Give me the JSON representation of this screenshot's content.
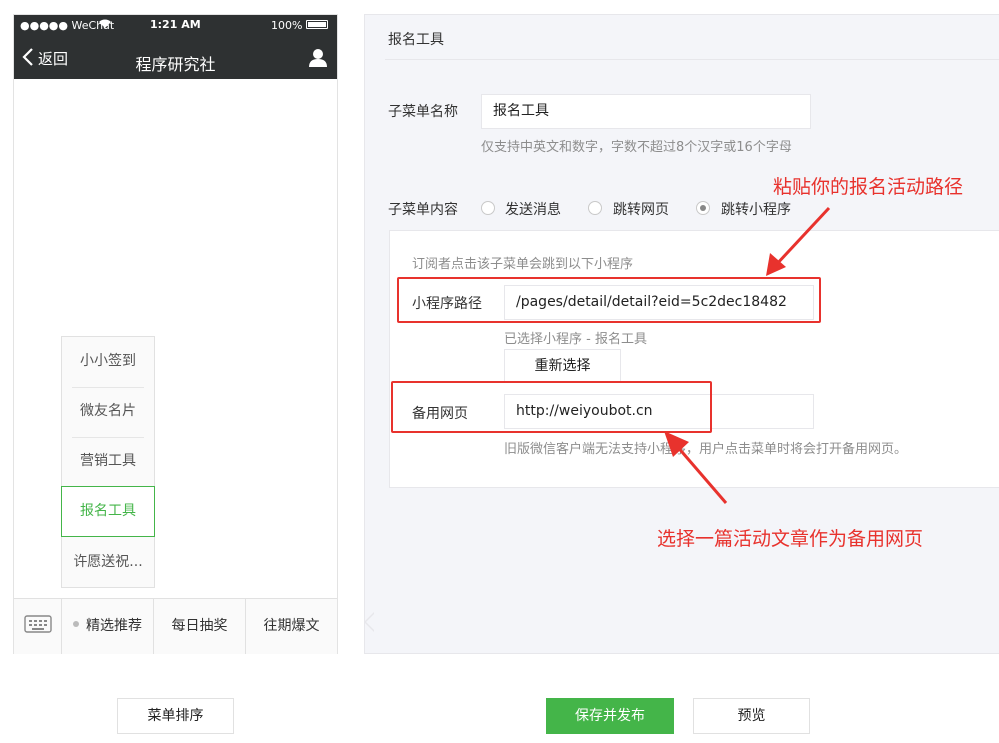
{
  "phone": {
    "status_bar": {
      "carrier": "●●●●● WeChat",
      "time": "1:21 AM",
      "battery": "100%"
    },
    "nav": {
      "back_label": "返回",
      "title": "程序研究社"
    },
    "submenu_items": [
      {
        "label": "小小签到"
      },
      {
        "label": "微友名片"
      },
      {
        "label": "营销工具"
      },
      {
        "label": "报名工具"
      },
      {
        "label": "许愿送祝..."
      }
    ],
    "menu_bar": [
      "精选推荐",
      "每日抽奖",
      "往期爆文"
    ]
  },
  "editor": {
    "title": "报名工具",
    "name_label": "子菜单名称",
    "name_value": "报名工具",
    "name_hint": "仅支持中英文和数字，字数不超过8个汉字或16个字母",
    "content_label": "子菜单内容",
    "content_options": [
      "发送消息",
      "跳转网页",
      "跳转小程序"
    ],
    "miniprogram": {
      "intro": "订阅者点击该子菜单会跳到以下小程序",
      "path_label": "小程序路径",
      "path_value": "/pages/detail/detail?eid=5c2dec18482",
      "selected_hint": "已选择小程序 - 报名工具",
      "reselect_button": "重新选择",
      "backup_label": "备用网页",
      "backup_value": "http://weiyoubot.cn",
      "backup_hint": "旧版微信客户端无法支持小程序，用户点击菜单时将会打开备用网页。"
    }
  },
  "annotations": {
    "top_note": "粘贴你的报名活动路径",
    "bottom_note": "选择一篇活动文章作为备用网页"
  },
  "footer": {
    "sort_button": "菜单排序",
    "save_button": "保存并发布",
    "preview_button": "预览"
  },
  "colors": {
    "accent_green": "#44b549",
    "annotation_red": "#e8322d",
    "statusbar_dark": "#2e3132"
  }
}
